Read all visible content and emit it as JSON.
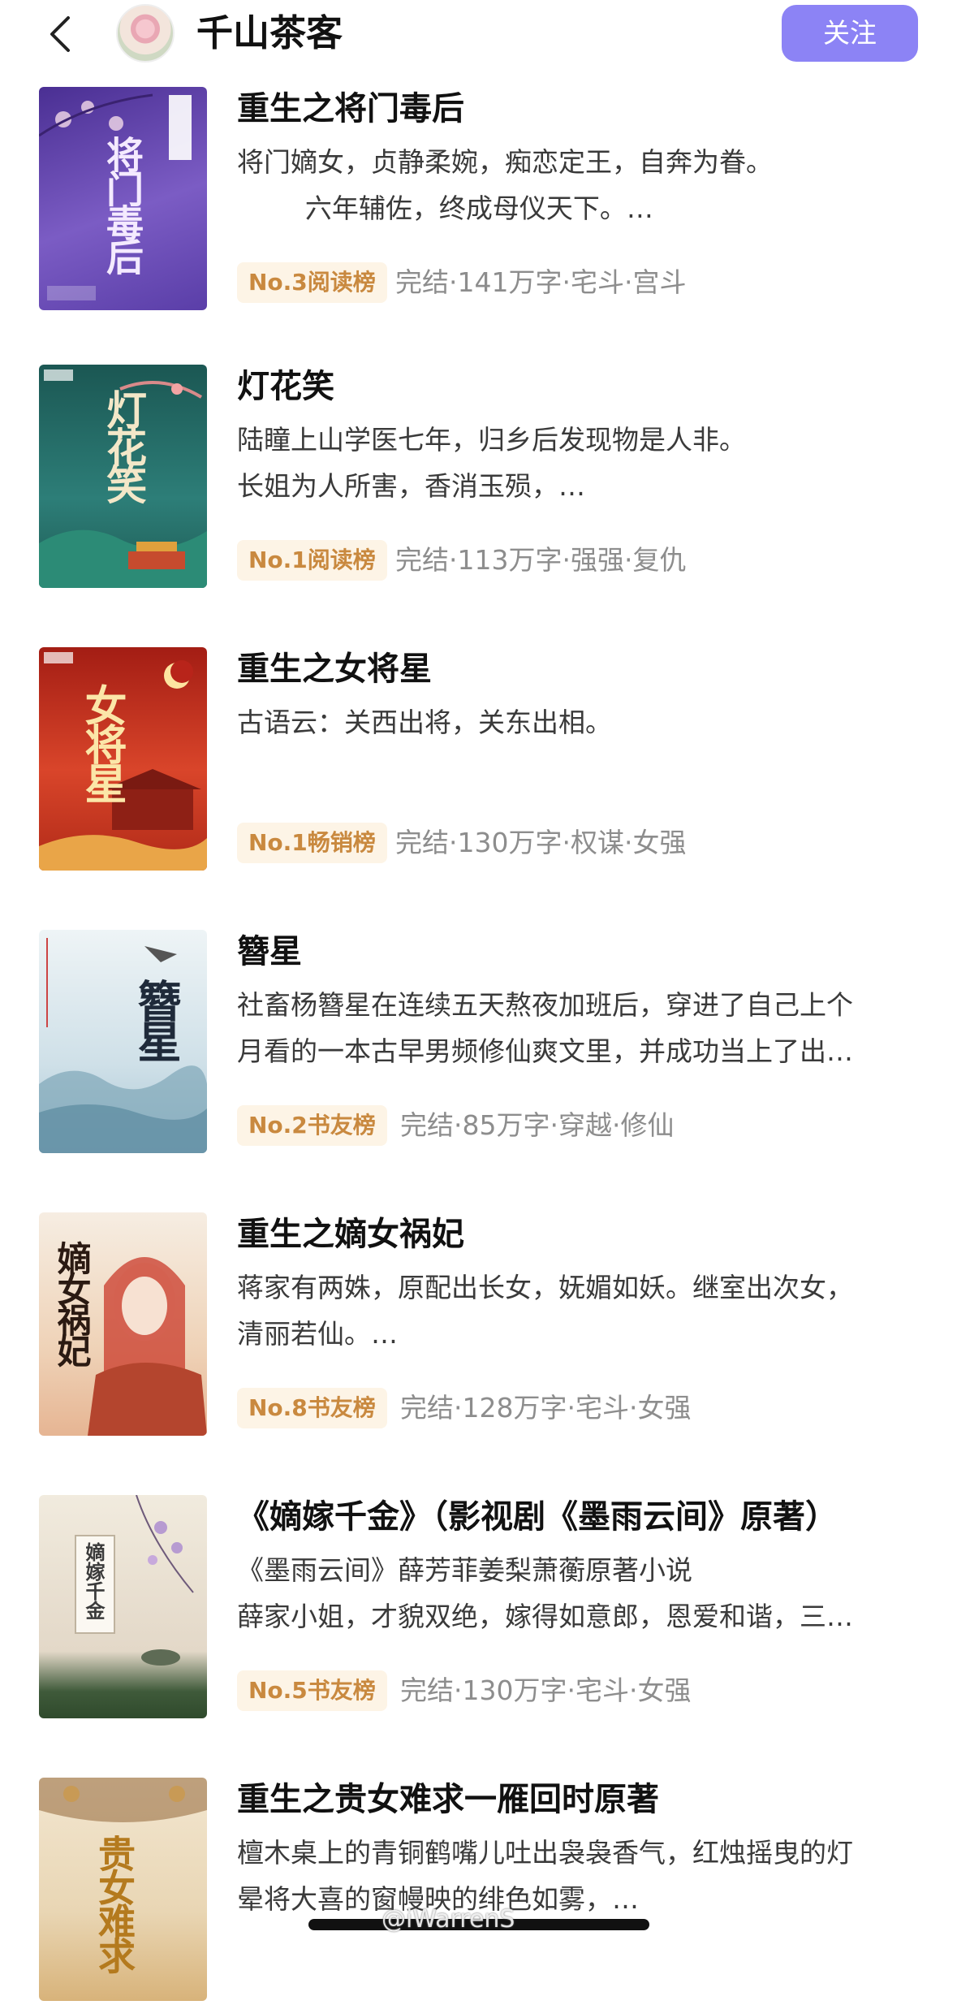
{
  "header": {
    "title": "千山茶客",
    "follow_label": "关注"
  },
  "books": [
    {
      "title": "重生之将门毒后",
      "desc": [
        "将门嫡女，贞静柔婉，痴恋定王，自奔为眷。",
        "        六年辅佐，终成母仪天下。…"
      ],
      "rank": "No.3阅读榜",
      "meta": "完结·141万字·宅斗·宫斗",
      "cover_title": "将门毒后",
      "cover_colors": [
        "#5b3ea6",
        "#8b6fcc"
      ]
    },
    {
      "title": "灯花笑",
      "desc": [
        "陆瞳上山学医七年，归乡后发现物是人非。",
        "长姐为人所害，香消玉殒，…"
      ],
      "rank": "No.1阅读榜",
      "meta": "完结·113万字·强强·复仇",
      "cover_title": "灯花笑",
      "cover_colors": [
        "#1d5e5a",
        "#2f8580"
      ]
    },
    {
      "title": "重生之女将星",
      "desc": [
        "古语云：关西出将，关东出相。",
        ""
      ],
      "rank": "No.1畅销榜",
      "meta": "完结·130万字·权谋·女强",
      "cover_title": "女将星",
      "cover_colors": [
        "#b8241a",
        "#e0532c"
      ]
    },
    {
      "title": "簪星",
      "desc": [
        "社畜杨簪星在连续五天熬夜加班后，穿进了自己上个",
        "月看的一本古早男频修仙爽文里，并成功当上了出…"
      ],
      "rank": "No.2书友榜",
      "meta": "完结·85万字·穿越·修仙",
      "cover_title": "簪星",
      "cover_colors": [
        "#dbe8ee",
        "#a9c8d6"
      ]
    },
    {
      "title": "重生之嫡女祸妃",
      "desc": [
        "蒋家有两姝，原配出长女，妩媚如妖。继室出次女，",
        "清丽若仙。…"
      ],
      "rank": "No.8书友榜",
      "meta": "完结·128万字·宅斗·女强",
      "cover_title": "嫡女祸妃",
      "cover_colors": [
        "#f3e6d6",
        "#e7b98f"
      ]
    },
    {
      "title": "《嫡嫁千金》（影视剧《墨雨云间》原著）",
      "desc": [
        "《墨雨云间》薛芳菲姜梨萧蘅原著小说",
        "薛家小姐，才貌双绝，嫁得如意郎，恩爱和谐，三…"
      ],
      "rank": "No.5书友榜",
      "meta": "完结·130万字·宅斗·女强",
      "cover_title": "嫡嫁千金",
      "cover_colors": [
        "#eee6d6",
        "#c9b9d6"
      ]
    },
    {
      "title": "重生之贵女难求一雁回时原著",
      "desc": [
        "檀木桌上的青铜鹤嘴儿吐出袅袅香气，红烛摇曳的灯",
        "晕将大喜的窗幔映的绯色如雾，…"
      ],
      "rank": "",
      "meta": "",
      "cover_title": "贵女难求",
      "cover_colors": [
        "#efe3cc",
        "#c89a55"
      ]
    }
  ],
  "watermark": "@iWarrenS"
}
